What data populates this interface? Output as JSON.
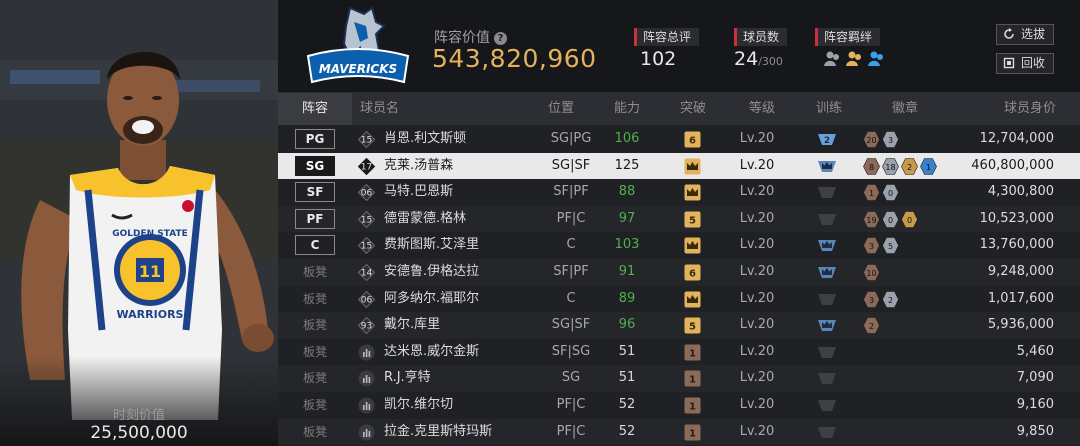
{
  "card": {
    "moment_value_label": "时刻价值",
    "moment_value": "25,500,000"
  },
  "header": {
    "lineup_value_label": "阵容价值",
    "lineup_value": "543,820,960",
    "stats": {
      "rating_label": "阵容总评",
      "rating_value": "102",
      "players_label": "球员数",
      "players_value": "24",
      "players_max": "/300",
      "bond_label": "阵容羁绊"
    },
    "buttons": {
      "select_label": "选拔",
      "recycle_label": "回收"
    },
    "team_logo_text": "MAVERICKS",
    "accent_color": "#e3b25c",
    "stat_accent": "#c8323c"
  },
  "columns": [
    "阵容",
    "球员名",
    "位置",
    "能力",
    "突破",
    "等级",
    "训练",
    "徽章",
    "球员身价"
  ],
  "rows": [
    {
      "slot": "PG",
      "starter": true,
      "number": "15",
      "name": "肖恩.利文斯顿",
      "position": "SG|PG",
      "ability": "106",
      "ability_green": true,
      "breakthrough": "6",
      "level": "Lv.20",
      "training": "2",
      "badges": [
        "20",
        "3"
      ],
      "price": "12,704,000"
    },
    {
      "slot": "SG",
      "starter": true,
      "selected": true,
      "number": "17",
      "name": "克莱.汤普森",
      "position": "SG|SF",
      "ability": "125",
      "ability_green": false,
      "breakthrough": "crown",
      "level": "Lv.20",
      "training": "crown",
      "badges": [
        "8",
        "18",
        "2",
        "1"
      ],
      "price": "460,800,000"
    },
    {
      "slot": "SF",
      "starter": true,
      "number": "06",
      "name": "马特.巴恩斯",
      "position": "SF|PF",
      "ability": "88",
      "ability_green": true,
      "breakthrough": "crown",
      "level": "Lv.20",
      "training": "none",
      "badges": [
        "1",
        "0"
      ],
      "price": "4,300,800"
    },
    {
      "slot": "PF",
      "starter": true,
      "number": "15",
      "name": "德雷蒙德.格林",
      "position": "PF|C",
      "ability": "97",
      "ability_green": true,
      "breakthrough": "5",
      "level": "Lv.20",
      "training": "none",
      "badges": [
        "19",
        "0",
        "0"
      ],
      "price": "10,523,000"
    },
    {
      "slot": "C",
      "starter": true,
      "number": "15",
      "name": "费斯图斯.艾泽里",
      "position": "C",
      "ability": "103",
      "ability_green": true,
      "breakthrough": "crown",
      "level": "Lv.20",
      "training": "crown",
      "badges": [
        "3",
        "5"
      ],
      "price": "13,760,000"
    },
    {
      "slot": "板凳",
      "starter": false,
      "number": "14",
      "name": "安德鲁.伊格达拉",
      "position": "SF|PF",
      "ability": "91",
      "ability_green": true,
      "breakthrough": "6",
      "level": "Lv.20",
      "training": "crown",
      "badges": [
        "10"
      ],
      "price": "9,248,000"
    },
    {
      "slot": "板凳",
      "starter": false,
      "number": "06",
      "name": "阿多纳尔.福耶尔",
      "position": "C",
      "ability": "89",
      "ability_green": true,
      "breakthrough": "crown",
      "level": "Lv.20",
      "training": "none",
      "badges": [
        "3",
        "2"
      ],
      "price": "1,017,600"
    },
    {
      "slot": "板凳",
      "starter": false,
      "number": "93",
      "name": "戴尔.库里",
      "position": "SG|SF",
      "ability": "96",
      "ability_green": true,
      "breakthrough": "5",
      "level": "Lv.20",
      "training": "crown",
      "badges": [
        "2"
      ],
      "price": "5,936,000"
    },
    {
      "slot": "板凳",
      "starter": false,
      "number": "bars",
      "name": "达米恩.威尔金斯",
      "position": "SF|SG",
      "ability": "51",
      "ability_green": false,
      "breakthrough": "1",
      "level": "Lv.20",
      "training": "none",
      "badges": [],
      "price": "5,460"
    },
    {
      "slot": "板凳",
      "starter": false,
      "number": "bars",
      "name": "R.J.亨特",
      "position": "SG",
      "ability": "51",
      "ability_green": false,
      "breakthrough": "1",
      "level": "Lv.20",
      "training": "none",
      "badges": [],
      "price": "7,090"
    },
    {
      "slot": "板凳",
      "starter": false,
      "number": "bars",
      "name": "凯尔.维尔切",
      "position": "PF|C",
      "ability": "52",
      "ability_green": false,
      "breakthrough": "1",
      "level": "Lv.20",
      "training": "none",
      "badges": [],
      "price": "9,160"
    },
    {
      "slot": "板凳",
      "starter": false,
      "number": "bars",
      "name": "拉金.克里斯特玛斯",
      "position": "PF|C",
      "ability": "52",
      "ability_green": false,
      "breakthrough": "1",
      "level": "Lv.20",
      "training": "none",
      "badges": [],
      "price": "9,850"
    }
  ]
}
